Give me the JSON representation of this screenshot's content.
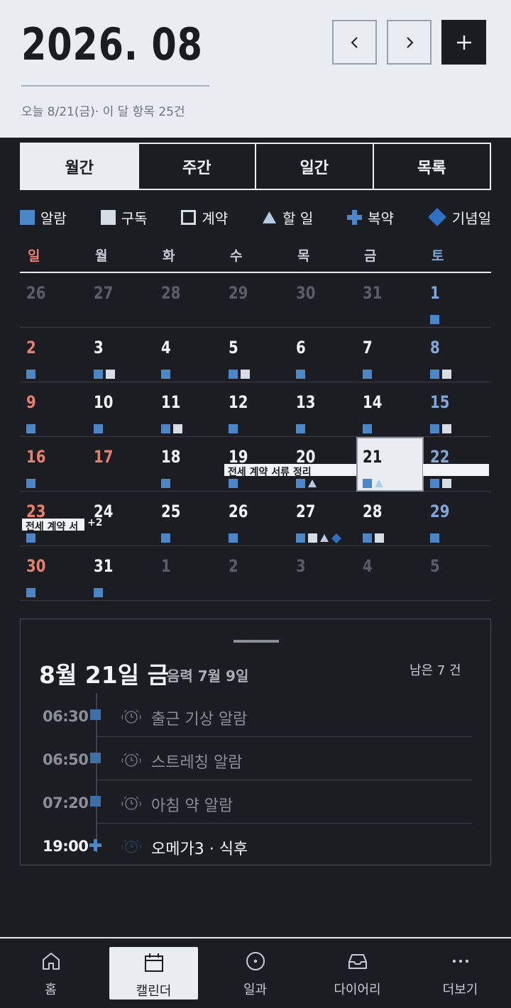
{
  "header": {
    "title": "2026. 08",
    "subtitle": "오늘 8/21(금)· 이 달 항목 25건",
    "prev_label": "prev",
    "next_label": "next",
    "add_label": "add"
  },
  "tabs": [
    {
      "label": "월간",
      "active": true
    },
    {
      "label": "주간",
      "active": false
    },
    {
      "label": "일간",
      "active": false
    },
    {
      "label": "목록",
      "active": false
    }
  ],
  "legend": [
    {
      "label": "알람",
      "icon": "alarm-square-icon",
      "color": "#4a86c8"
    },
    {
      "label": "구독",
      "icon": "subscription-square-icon",
      "color": "#d4dce6"
    },
    {
      "label": "계약",
      "icon": "contract-outline-square-icon",
      "color": "#4a86c8"
    },
    {
      "label": "할 일",
      "icon": "task-triangle-icon",
      "color": "#b6cbe2"
    },
    {
      "label": "복약",
      "icon": "medication-cross-icon",
      "color": "#4a86c8"
    },
    {
      "label": "기념일",
      "icon": "anniversary-diamond-icon",
      "color": "#2f6fc4"
    }
  ],
  "weekdays": [
    "일",
    "월",
    "화",
    "수",
    "목",
    "금",
    "토"
  ],
  "weeks": [
    [
      {
        "d": "26",
        "other": true,
        "marks": []
      },
      {
        "d": "27",
        "other": true,
        "marks": []
      },
      {
        "d": "28",
        "other": true,
        "marks": []
      },
      {
        "d": "29",
        "other": true,
        "marks": []
      },
      {
        "d": "30",
        "other": true,
        "marks": []
      },
      {
        "d": "31",
        "other": true,
        "marks": []
      },
      {
        "d": "1",
        "marks": [
          "alarm"
        ]
      }
    ],
    [
      {
        "d": "2",
        "marks": [
          "alarm"
        ]
      },
      {
        "d": "3",
        "marks": [
          "alarm",
          "sub"
        ]
      },
      {
        "d": "4",
        "marks": [
          "alarm"
        ]
      },
      {
        "d": "5",
        "marks": [
          "alarm",
          "sub"
        ]
      },
      {
        "d": "6",
        "marks": [
          "alarm"
        ]
      },
      {
        "d": "7",
        "marks": [
          "alarm"
        ]
      },
      {
        "d": "8",
        "marks": [
          "alarm",
          "sub"
        ]
      }
    ],
    [
      {
        "d": "9",
        "marks": [
          "alarm"
        ]
      },
      {
        "d": "10",
        "marks": [
          "alarm"
        ]
      },
      {
        "d": "11",
        "marks": [
          "alarm",
          "sub"
        ]
      },
      {
        "d": "12",
        "marks": [
          "alarm"
        ]
      },
      {
        "d": "13",
        "marks": [
          "alarm"
        ]
      },
      {
        "d": "14",
        "marks": [
          "alarm"
        ]
      },
      {
        "d": "15",
        "marks": [
          "alarm",
          "sub"
        ]
      }
    ],
    [
      {
        "d": "16",
        "marks": [
          "alarm"
        ]
      },
      {
        "d": "17",
        "holiday": true,
        "marks": []
      },
      {
        "d": "18",
        "marks": [
          "alarm"
        ]
      },
      {
        "d": "19",
        "marks": [
          "alarm"
        ]
      },
      {
        "d": "20",
        "marks": [
          "alarm",
          "task"
        ]
      },
      {
        "d": "21",
        "today": true,
        "marks": [
          "alarm",
          "task"
        ]
      },
      {
        "d": "22",
        "marks": [
          "alarm",
          "sub"
        ]
      }
    ],
    [
      {
        "d": "23",
        "marks": [
          "alarm"
        ]
      },
      {
        "d": "24",
        "marks": []
      },
      {
        "d": "25",
        "marks": [
          "alarm"
        ]
      },
      {
        "d": "26",
        "marks": [
          "alarm"
        ]
      },
      {
        "d": "27",
        "marks": [
          "alarm",
          "sub",
          "task",
          "anni"
        ]
      },
      {
        "d": "28",
        "marks": [
          "alarm",
          "sub"
        ]
      },
      {
        "d": "29",
        "marks": [
          "alarm"
        ]
      }
    ],
    [
      {
        "d": "30",
        "marks": [
          "alarm"
        ]
      },
      {
        "d": "31",
        "marks": [
          "alarm"
        ]
      },
      {
        "d": "1",
        "other": true,
        "marks": []
      },
      {
        "d": "2",
        "other": true,
        "marks": []
      },
      {
        "d": "3",
        "other": true,
        "marks": []
      },
      {
        "d": "4",
        "other": true,
        "marks": []
      },
      {
        "d": "5",
        "other": true,
        "marks": []
      }
    ]
  ],
  "events": {
    "week4": "전세 계약 서류 정리",
    "week5": "전세 계약 서",
    "week5_more": "+2"
  },
  "detail": {
    "date": "8월 21일 금",
    "lunar": "음력 7월 9일",
    "remaining": "남은  7 건",
    "items": [
      {
        "time": "06:30",
        "label": "출근 기상 알람",
        "type": "alarm",
        "done": true
      },
      {
        "time": "06:50",
        "label": "스트레칭 알람",
        "type": "alarm",
        "done": true
      },
      {
        "time": "07:20",
        "label": "아침 약 알람",
        "type": "alarm",
        "done": true
      },
      {
        "time": "19:00",
        "label": "오메가3 · 식후",
        "type": "medication",
        "done": false
      }
    ]
  },
  "bottom_nav": [
    {
      "label": "홈",
      "icon": "home-icon",
      "active": false
    },
    {
      "label": "캘린더",
      "icon": "calendar-icon",
      "active": true
    },
    {
      "label": "일과",
      "icon": "routine-circle-icon",
      "active": false
    },
    {
      "label": "다이어리",
      "icon": "inbox-tray-icon",
      "active": false
    },
    {
      "label": "더보기",
      "icon": "more-dots-icon",
      "active": false
    }
  ]
}
